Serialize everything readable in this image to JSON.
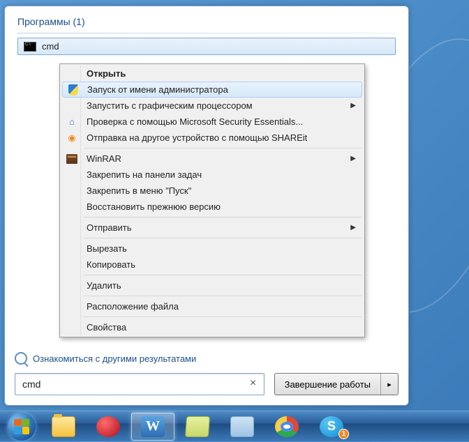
{
  "section": {
    "title": "Программы (1)"
  },
  "result": {
    "label": "cmd"
  },
  "menu": {
    "open": "Открыть",
    "run_as_admin": "Запуск от имени администратора",
    "run_gpu": "Запустить с графическим процессором",
    "mse": "Проверка с помощью Microsoft Security Essentials...",
    "shareit": "Отправка на другое устройство с помощью SHAREit",
    "winrar": "WinRAR",
    "pin_taskbar": "Закрепить на панели задач",
    "pin_start": "Закрепить в меню \"Пуск\"",
    "restore": "Восстановить прежнюю версию",
    "send_to": "Отправить",
    "cut": "Вырезать",
    "copy": "Копировать",
    "delete": "Удалить",
    "file_location": "Расположение файла",
    "properties": "Свойства"
  },
  "other_results": "Ознакомиться с другими результатами",
  "search": {
    "value": "cmd",
    "clear": "×"
  },
  "shutdown": {
    "label": "Завершение работы",
    "arrow": "▸"
  },
  "taskbar": {
    "word_letter": "W",
    "skype_letter": "S",
    "skype_badge": "1"
  }
}
